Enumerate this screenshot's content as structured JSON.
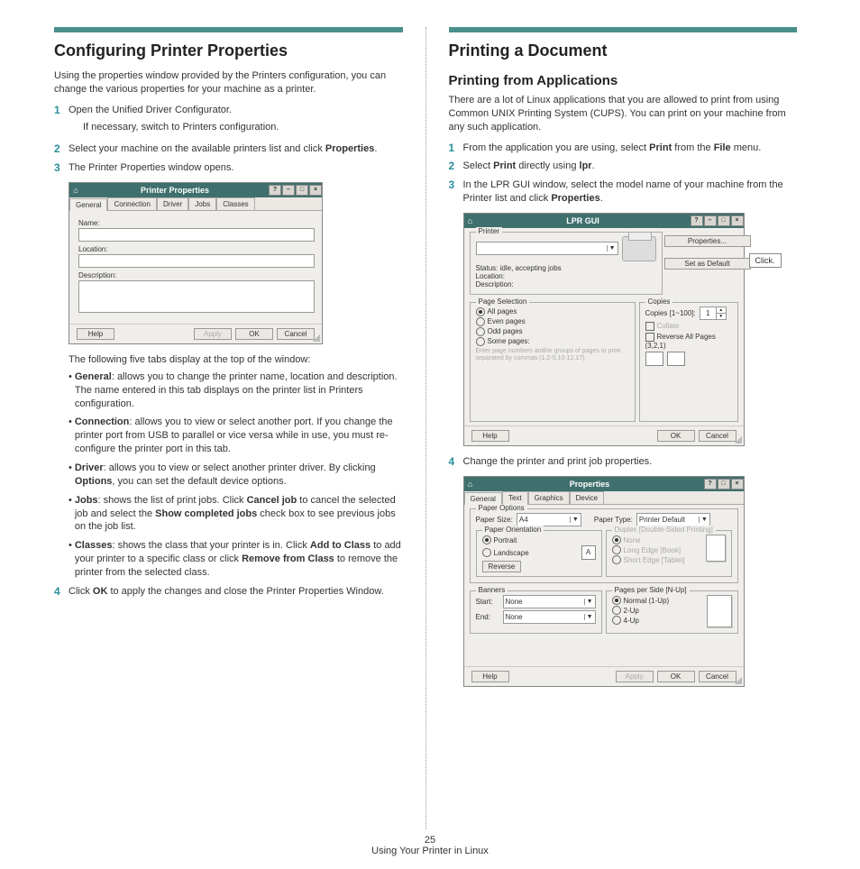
{
  "left": {
    "title": "Configuring Printer Properties",
    "intro": "Using the properties window provided by the Printers configuration, you can change the various properties for your machine as a printer.",
    "step1": "Open the Unified Driver Configurator.",
    "step1_sub": "If necessary, switch to Printers configuration.",
    "step2_a": "Select your machine on the available printers list and click ",
    "step2_b": "Properties",
    "step2_c": ".",
    "step3": "The Printer Properties window opens.",
    "tabs_intro": "The following five tabs display at the top of the window:",
    "b_general_t": "General",
    "b_general": ": allows you to change the printer name, location and description. The name entered in this tab displays on the printer list in Printers configuration.",
    "b_conn_t": "Connection",
    "b_conn": ": allows you to view or select another port. If you change the printer port from USB to parallel or vice versa while in use, you must re-configure the printer port in this tab.",
    "b_driver_t": "Driver",
    "b_driver_a": ": allows you to view or select another printer driver. By clicking ",
    "b_driver_b": "Options",
    "b_driver_c": ", you can set the default device options.",
    "b_jobs_t": "Jobs",
    "b_jobs_a": ": shows the list of print jobs. Click ",
    "b_jobs_b": "Cancel job",
    "b_jobs_c": " to cancel the selected job and select the ",
    "b_jobs_d": "Show completed jobs",
    "b_jobs_e": " check box to see previous jobs on the job list.",
    "b_classes_t": "Classes",
    "b_classes_a": ": shows the class that your printer is in. Click ",
    "b_classes_b": "Add to Class",
    "b_classes_c": " to add your printer to a specific class or click ",
    "b_classes_d": "Remove from Class",
    "b_classes_e": " to remove the printer from the selected class.",
    "step4_a": "Click ",
    "step4_b": "OK",
    "step4_c": " to apply the changes and close the Printer Properties Window.",
    "dlg": {
      "title": "Printer Properties",
      "tabs": [
        "General",
        "Connection",
        "Driver",
        "Jobs",
        "Classes"
      ],
      "name": "Name:",
      "location": "Location:",
      "description": "Description:",
      "help": "Help",
      "apply": "Apply",
      "ok": "OK",
      "cancel": "Cancel"
    }
  },
  "right": {
    "title": "Printing a Document",
    "subtitle": "Printing from Applications",
    "intro": "There are a lot of Linux applications that you are allowed to print from using Common UNIX Printing System (CUPS). You can print on your machine from any such application.",
    "s1_a": "From the application you are using, select ",
    "s1_b": "Print",
    "s1_c": " from the ",
    "s1_d": "File",
    "s1_e": " menu.",
    "s2_a": "Select ",
    "s2_b": "Print",
    "s2_c": " directly using ",
    "s2_d": "lpr",
    "s2_e": ".",
    "s3_a": "In the LPR GUI window, select the model name of your machine from the Printer list and click ",
    "s3_b": "Properties",
    "s3_c": ".",
    "click": "Click.",
    "s4": "Change the printer and print job properties.",
    "lpr": {
      "title": "LPR GUI",
      "printer": "Printer",
      "status": "Status: idle, accepting jobs",
      "location": "Location:",
      "description": "Description:",
      "properties": "Properties...",
      "setdefault": "Set as Default",
      "pagesel": "Page Selection",
      "all": "All pages",
      "even": "Even pages",
      "odd": "Odd pages",
      "some": "Some pages:",
      "somehint": "Enter page numbers and/or groups of pages to print separated by commas (1,2-5,10-12,17).",
      "copies": "Copies",
      "copieslbl": "Copies [1~100]:",
      "copiesval": "1",
      "collate": "Collate",
      "reverse": "Reverse All Pages (3,2,1)",
      "help": "Help",
      "ok": "OK",
      "cancel": "Cancel"
    },
    "props": {
      "title": "Properties",
      "tabs": [
        "General",
        "Text",
        "Graphics",
        "Device"
      ],
      "paperopts": "Paper Options",
      "papersize": "Paper Size:",
      "a4": "A4",
      "papertype": "Paper Type:",
      "pdefault": "Printer Default",
      "orient": "Paper Orientation",
      "portrait": "Portrait",
      "landscape": "Landscape",
      "reverse": "Reverse",
      "duplex": "Duplex [Double-Sided Printing]",
      "dnone": "None",
      "dlong": "Long Edge [Book]",
      "dshort": "Short Edge [Tablet]",
      "banners": "Banners",
      "start": "Start:",
      "end": "End:",
      "none": "None",
      "pps": "Pages per Side [N-Up]",
      "n1": "Normal (1-Up)",
      "n2": "2-Up",
      "n4": "4-Up",
      "help": "Help",
      "apply": "Apply",
      "ok": "OK",
      "cancel": "Cancel"
    }
  },
  "footer": {
    "page": "25",
    "section": "Using Your Printer in Linux"
  }
}
